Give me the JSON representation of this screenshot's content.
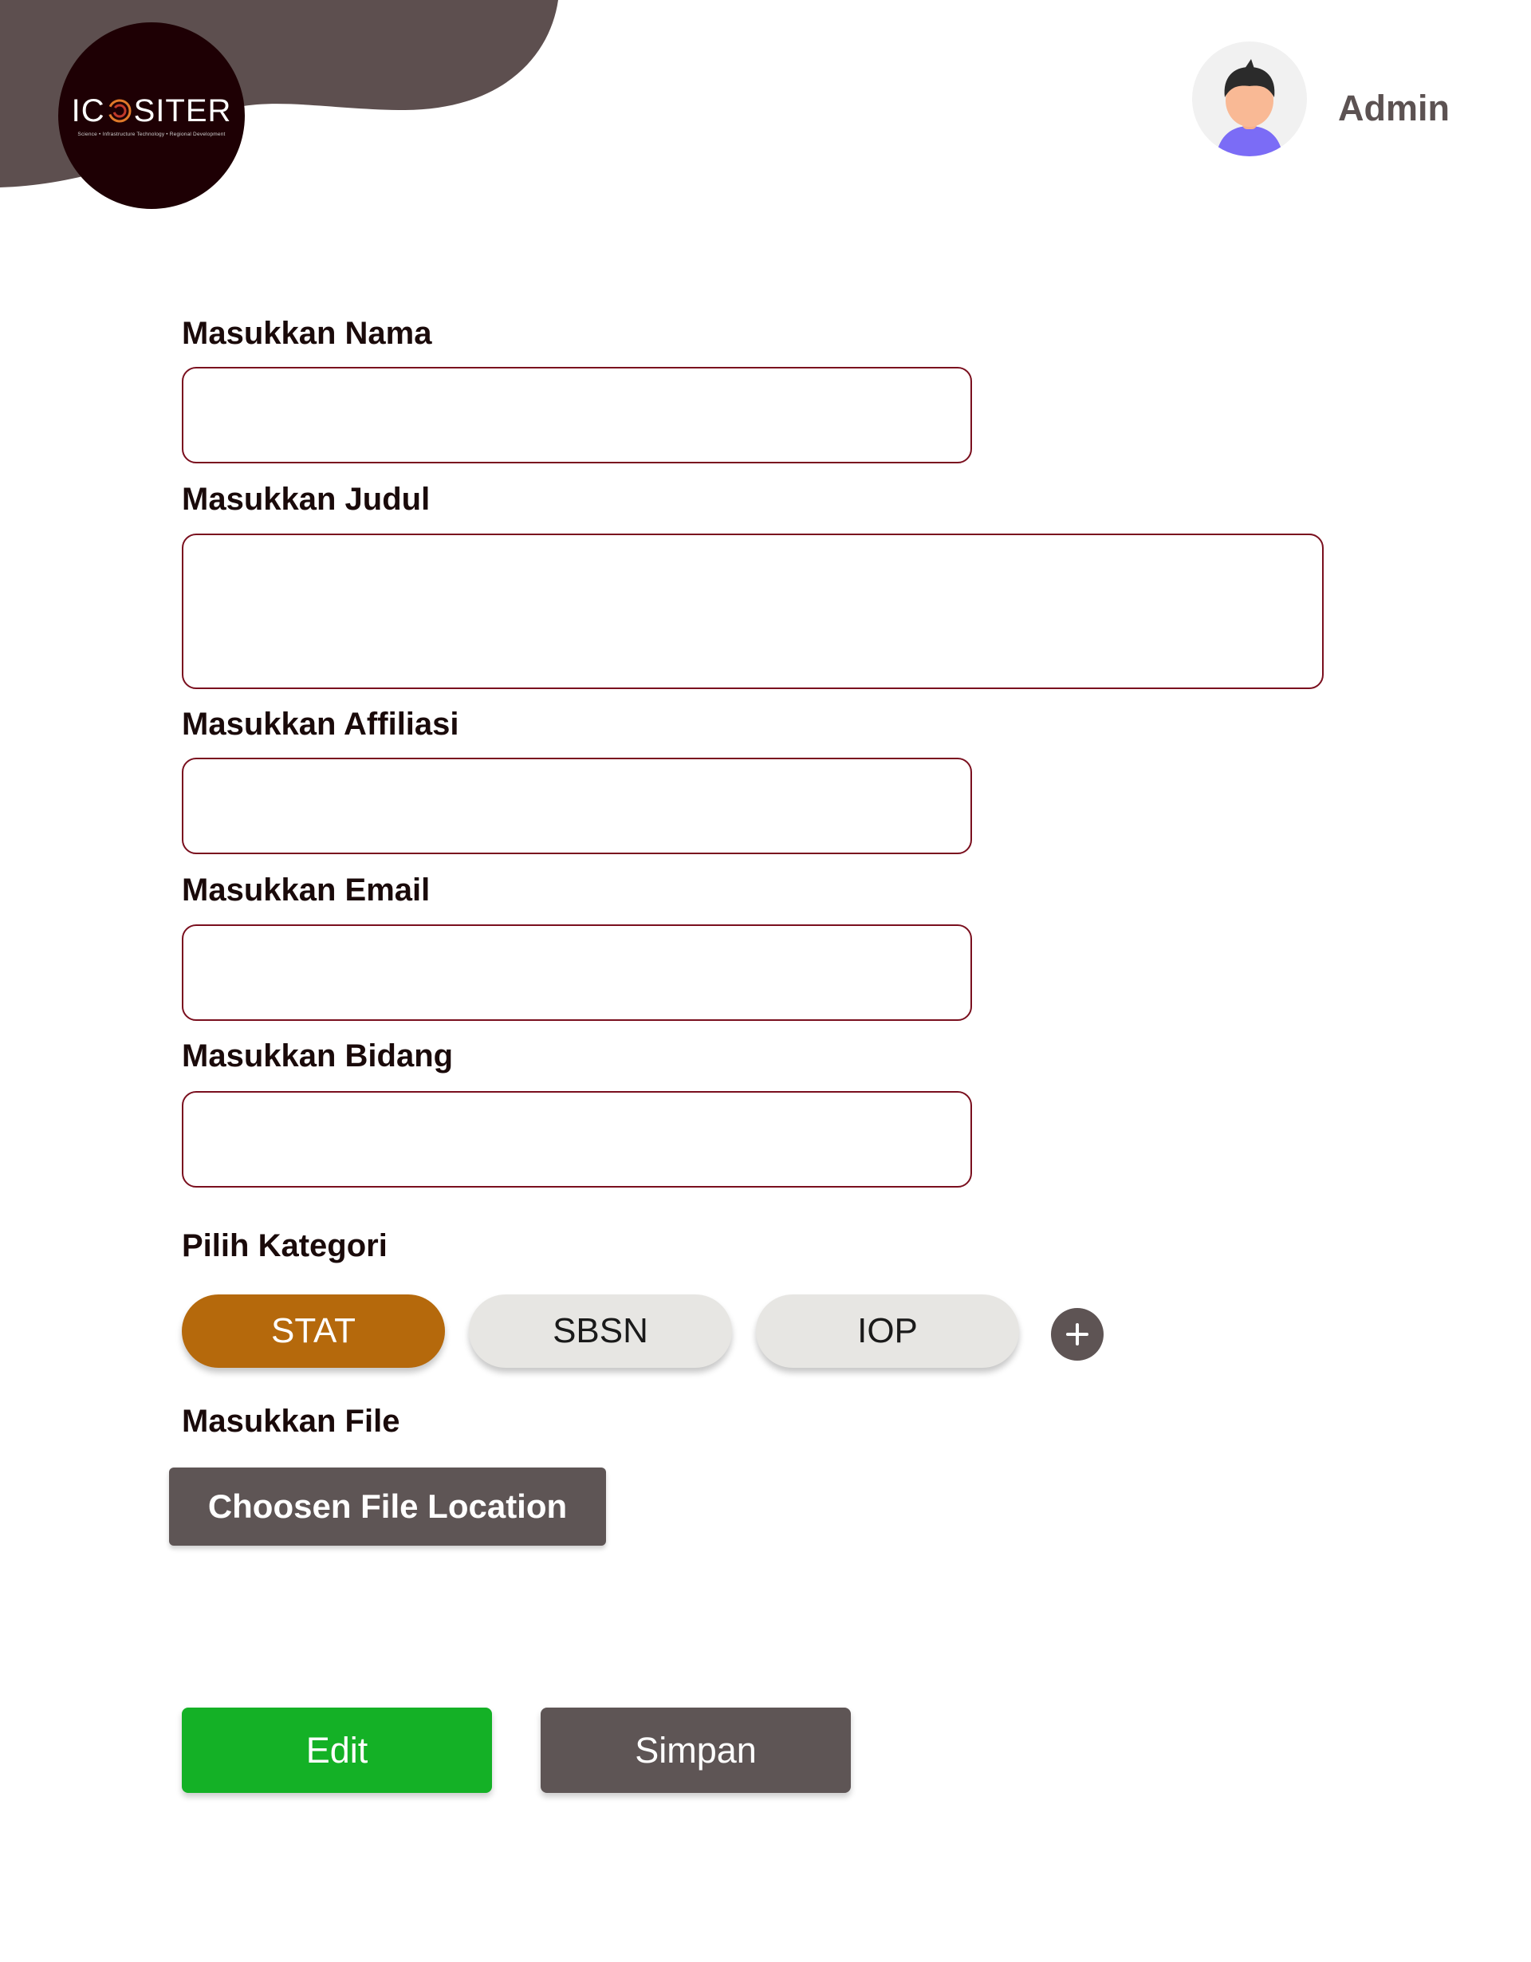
{
  "header": {
    "logo": {
      "left_text": "IC",
      "right_text": "SITER",
      "tagline": "Science • Infrastructure Technology • Regional Development"
    },
    "user": {
      "name": "Admin",
      "icon": "user-avatar-icon"
    }
  },
  "form": {
    "nama_label": "Masukkan Nama",
    "nama_value": "",
    "judul_label": "Masukkan Judul",
    "judul_value": "",
    "affiliasi_label": "Masukkan Affiliasi",
    "affiliasi_value": "",
    "email_label": "Masukkan Email",
    "email_value": "",
    "bidang_label": "Masukkan Bidang",
    "bidang_value": "",
    "kategori_label": "Pilih Kategori",
    "kategori": [
      {
        "label": "STAT",
        "selected": true
      },
      {
        "label": "SBSN",
        "selected": false
      },
      {
        "label": "IOP",
        "selected": false
      }
    ],
    "add_category_icon": "plus-icon",
    "file_label": "Masukkan File",
    "file_button": "Choosen File Location"
  },
  "actions": {
    "edit": "Edit",
    "save": "Simpan"
  },
  "colors": {
    "header_blob": "#5d4f4f",
    "logo_bg": "#1e0004",
    "field_border": "#7a0f1e",
    "chip_active": "#b5690c",
    "chip_inactive": "#e7e6e3",
    "edit_button": "#14b126",
    "dark_button": "#5e5555"
  }
}
